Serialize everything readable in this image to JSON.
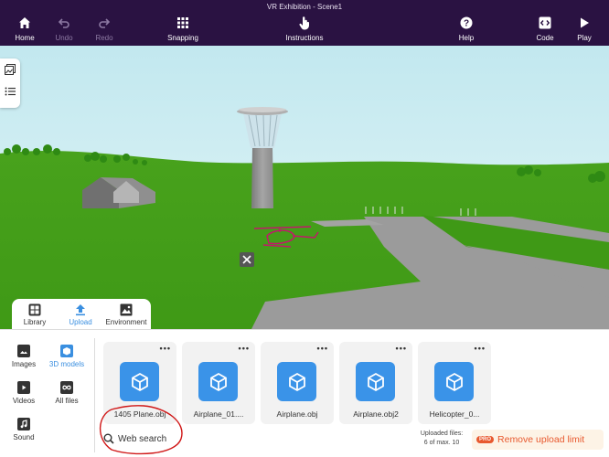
{
  "window": {
    "title": "VR Exhibition - Scene1"
  },
  "toolbar": {
    "home": "Home",
    "undo": "Undo",
    "redo": "Redo",
    "snapping": "Snapping",
    "instructions": "Instructions",
    "help": "Help",
    "code": "Code",
    "play": "Play"
  },
  "asset_tabs": [
    {
      "label": "Library",
      "icon": "library-icon",
      "active": false
    },
    {
      "label": "Upload",
      "icon": "upload-icon",
      "active": true
    },
    {
      "label": "Environment",
      "icon": "environment-icon",
      "active": false
    }
  ],
  "categories": [
    {
      "label": "Images",
      "icon": "image-icon",
      "active": false
    },
    {
      "label": "3D models",
      "icon": "cube-icon",
      "active": true
    },
    {
      "label": "Videos",
      "icon": "video-icon",
      "active": false
    },
    {
      "label": "All files",
      "icon": "infinity-icon",
      "active": false
    },
    {
      "label": "Sound",
      "icon": "music-icon",
      "active": false
    }
  ],
  "files": [
    {
      "name": "1405 Plane.obj"
    },
    {
      "name": "Airplane_01...."
    },
    {
      "name": "Airplane.obj"
    },
    {
      "name": "Airplane.obj2"
    },
    {
      "name": "Helicopter_0..."
    }
  ],
  "search": {
    "label": "Web search"
  },
  "upload_info": {
    "line1": "Uploaded files:",
    "line2": "6 of max. 10"
  },
  "pro": {
    "badge": "PRO",
    "label": "Remove upload limit"
  },
  "colors": {
    "topbar": "#2a1242",
    "accent": "#3a8fe0",
    "pro": "#e8592f",
    "grass": "#4aa01e",
    "sky": "#d6f0f6"
  }
}
